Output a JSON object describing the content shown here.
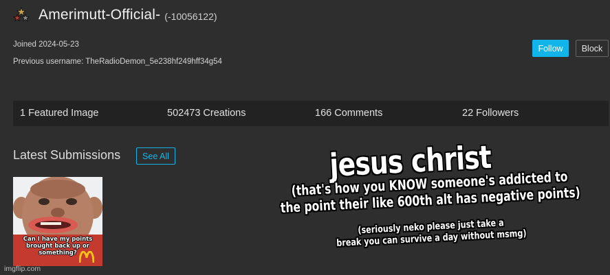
{
  "profile": {
    "username": "Amerimutt-Official-",
    "points": "(-10056122)",
    "joined": "Joined 2024-05-23",
    "previous_username": "Previous username: TheRadioDemon_5e238hf249hff34g54",
    "avatar_icon": "badge-stars-icon"
  },
  "actions": {
    "follow_label": "Follow",
    "block_label": "Block"
  },
  "stats": {
    "featured": "1 Featured Image",
    "creations": "502473 Creations",
    "comments": "166 Comments",
    "followers": "22 Followers"
  },
  "latest": {
    "title": "Latest Submissions",
    "see_all_label": "See All",
    "thumbnail_caption": "Can I have my points brought back up or something?"
  },
  "overlay_text": {
    "line1": "jesus christ",
    "line2a": "(that's how you KNOW someone's addicted to",
    "line2b": "the point their like 600th alt has negative points)",
    "line3a": "(seriously neko please just take a",
    "line3b": "break you can survive a day without msmg)"
  },
  "watermark": "imgflip.com",
  "colors": {
    "accent": "#12b5ea",
    "background": "#2e2e2e",
    "stats_bar": "#222222"
  }
}
